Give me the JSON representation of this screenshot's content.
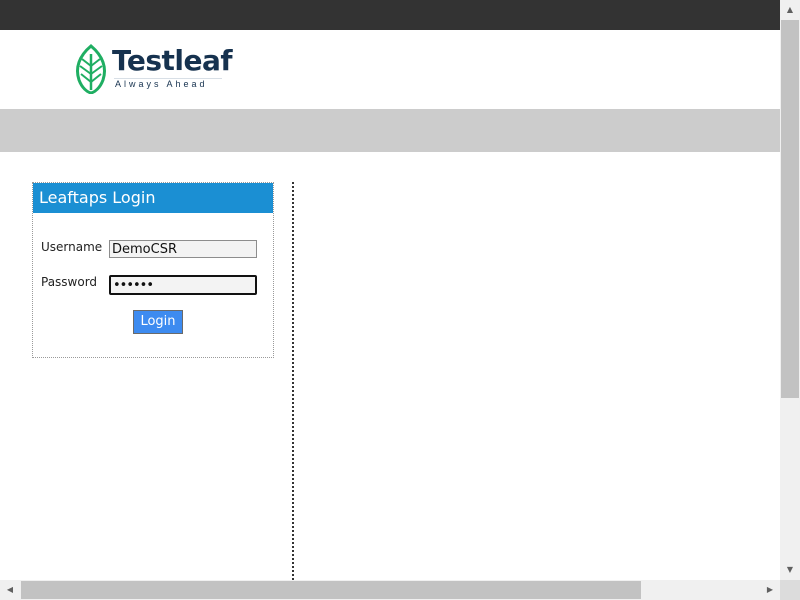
{
  "brand": {
    "name": "Testleaf",
    "tagline": "Always Ahead",
    "logo_icon": "leaf-icon",
    "logo_color": "#1fae62",
    "name_color": "#16324f"
  },
  "login_panel": {
    "title": "Leaftaps Login",
    "title_bg": "#1b8fd3",
    "username_label": "Username",
    "username_value": "DemoCSR",
    "password_label": "Password",
    "password_value": "••••••",
    "login_button_label": "Login",
    "login_button_color": "#3d8bf0"
  },
  "scrollbars": {
    "up_arrow": "▲",
    "down_arrow": "▼",
    "left_arrow": "◀",
    "right_arrow": "▶"
  },
  "colors": {
    "top_bar": "#333333",
    "nav_bar": "#cccccc"
  }
}
